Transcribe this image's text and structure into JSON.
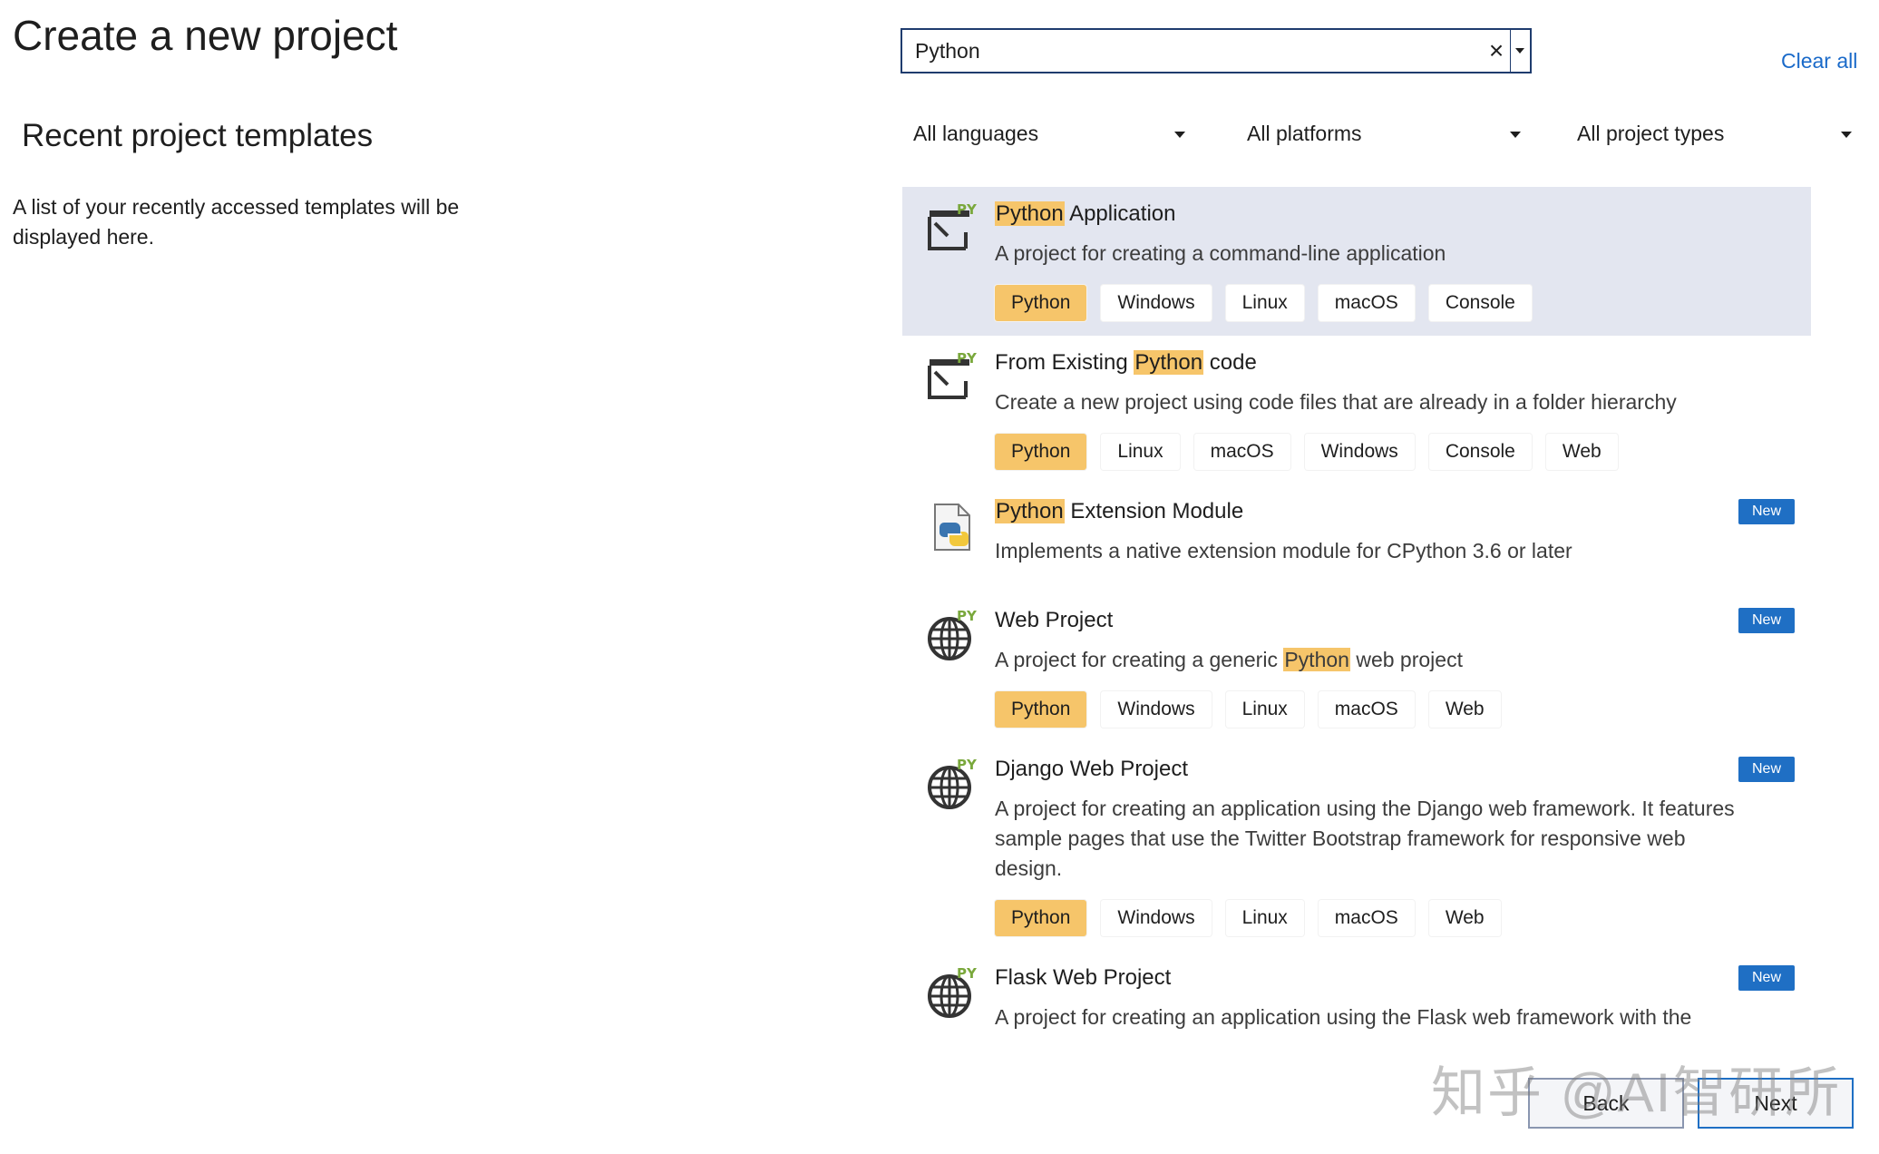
{
  "page": {
    "title": "Create a new project"
  },
  "recent": {
    "heading": "Recent project templates",
    "description": "A list of your recently accessed templates will be displayed here."
  },
  "search": {
    "value": "Python",
    "clear_icon": "×"
  },
  "clear_all": "Clear all",
  "filters": {
    "languages": "All languages",
    "platforms": "All platforms",
    "project_types": "All project types"
  },
  "templates": [
    {
      "name_pre": "",
      "name_hl": "Python",
      "name_post": " Application",
      "description_pre": "A project for creating a command-line application",
      "description_hl": "",
      "description_post": "",
      "tags": [
        "Python",
        "Windows",
        "Linux",
        "macOS",
        "Console"
      ],
      "icon": "console-app-py-icon",
      "badge": ""
    },
    {
      "name_pre": "From Existing ",
      "name_hl": "Python",
      "name_post": " code",
      "description_pre": "Create a new project using code files that are already in a folder hierarchy",
      "description_hl": "",
      "description_post": "",
      "tags": [
        "Python",
        "Linux",
        "macOS",
        "Windows",
        "Console",
        "Web"
      ],
      "icon": "console-app-py-icon",
      "badge": ""
    },
    {
      "name_pre": "",
      "name_hl": "Python",
      "name_post": " Extension Module",
      "description_pre": "Implements a native extension module for CPython 3.6 or later",
      "description_hl": "",
      "description_post": "",
      "tags": [],
      "icon": "python-file-icon",
      "badge": "New"
    },
    {
      "name_pre": "Web Project",
      "name_hl": "",
      "name_post": "",
      "description_pre": "A project for creating a generic ",
      "description_hl": "Python",
      "description_post": " web project",
      "tags": [
        "Python",
        "Windows",
        "Linux",
        "macOS",
        "Web"
      ],
      "icon": "globe-py-icon",
      "badge": "New"
    },
    {
      "name_pre": "Django Web Project",
      "name_hl": "",
      "name_post": "",
      "description_pre": "A project for creating an application using the Django web framework. It features sample pages that use the Twitter Bootstrap framework for responsive web design.",
      "description_hl": "",
      "description_post": "",
      "tags": [
        "Python",
        "Windows",
        "Linux",
        "macOS",
        "Web"
      ],
      "icon": "globe-py-icon",
      "badge": "New"
    },
    {
      "name_pre": "Flask Web Project",
      "name_hl": "",
      "name_post": "",
      "description_pre": "A project for creating an application using the Flask web framework with the",
      "description_hl": "",
      "description_post": "",
      "tags": [],
      "icon": "globe-py-icon",
      "badge": "New"
    }
  ],
  "buttons": {
    "back": "Back",
    "next": "Next"
  },
  "watermark": "知乎 @AI智研所",
  "colors": {
    "accent": "#1f6fc4",
    "highlight": "#f6c56a",
    "selected_bg": "#e3e6f0",
    "link": "#1a6ac9"
  }
}
